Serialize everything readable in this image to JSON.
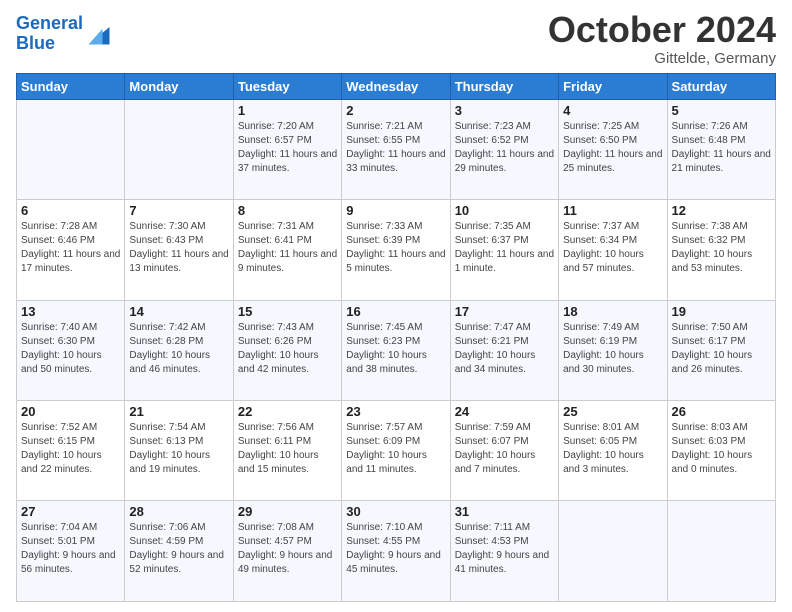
{
  "header": {
    "logo_general": "General",
    "logo_blue": "Blue",
    "month": "October 2024",
    "location": "Gittelde, Germany"
  },
  "days_of_week": [
    "Sunday",
    "Monday",
    "Tuesday",
    "Wednesday",
    "Thursday",
    "Friday",
    "Saturday"
  ],
  "weeks": [
    [
      {
        "day": "",
        "sunrise": "",
        "sunset": "",
        "daylight": ""
      },
      {
        "day": "",
        "sunrise": "",
        "sunset": "",
        "daylight": ""
      },
      {
        "day": "1",
        "sunrise": "Sunrise: 7:20 AM",
        "sunset": "Sunset: 6:57 PM",
        "daylight": "Daylight: 11 hours and 37 minutes."
      },
      {
        "day": "2",
        "sunrise": "Sunrise: 7:21 AM",
        "sunset": "Sunset: 6:55 PM",
        "daylight": "Daylight: 11 hours and 33 minutes."
      },
      {
        "day": "3",
        "sunrise": "Sunrise: 7:23 AM",
        "sunset": "Sunset: 6:52 PM",
        "daylight": "Daylight: 11 hours and 29 minutes."
      },
      {
        "day": "4",
        "sunrise": "Sunrise: 7:25 AM",
        "sunset": "Sunset: 6:50 PM",
        "daylight": "Daylight: 11 hours and 25 minutes."
      },
      {
        "day": "5",
        "sunrise": "Sunrise: 7:26 AM",
        "sunset": "Sunset: 6:48 PM",
        "daylight": "Daylight: 11 hours and 21 minutes."
      }
    ],
    [
      {
        "day": "6",
        "sunrise": "Sunrise: 7:28 AM",
        "sunset": "Sunset: 6:46 PM",
        "daylight": "Daylight: 11 hours and 17 minutes."
      },
      {
        "day": "7",
        "sunrise": "Sunrise: 7:30 AM",
        "sunset": "Sunset: 6:43 PM",
        "daylight": "Daylight: 11 hours and 13 minutes."
      },
      {
        "day": "8",
        "sunrise": "Sunrise: 7:31 AM",
        "sunset": "Sunset: 6:41 PM",
        "daylight": "Daylight: 11 hours and 9 minutes."
      },
      {
        "day": "9",
        "sunrise": "Sunrise: 7:33 AM",
        "sunset": "Sunset: 6:39 PM",
        "daylight": "Daylight: 11 hours and 5 minutes."
      },
      {
        "day": "10",
        "sunrise": "Sunrise: 7:35 AM",
        "sunset": "Sunset: 6:37 PM",
        "daylight": "Daylight: 11 hours and 1 minute."
      },
      {
        "day": "11",
        "sunrise": "Sunrise: 7:37 AM",
        "sunset": "Sunset: 6:34 PM",
        "daylight": "Daylight: 10 hours and 57 minutes."
      },
      {
        "day": "12",
        "sunrise": "Sunrise: 7:38 AM",
        "sunset": "Sunset: 6:32 PM",
        "daylight": "Daylight: 10 hours and 53 minutes."
      }
    ],
    [
      {
        "day": "13",
        "sunrise": "Sunrise: 7:40 AM",
        "sunset": "Sunset: 6:30 PM",
        "daylight": "Daylight: 10 hours and 50 minutes."
      },
      {
        "day": "14",
        "sunrise": "Sunrise: 7:42 AM",
        "sunset": "Sunset: 6:28 PM",
        "daylight": "Daylight: 10 hours and 46 minutes."
      },
      {
        "day": "15",
        "sunrise": "Sunrise: 7:43 AM",
        "sunset": "Sunset: 6:26 PM",
        "daylight": "Daylight: 10 hours and 42 minutes."
      },
      {
        "day": "16",
        "sunrise": "Sunrise: 7:45 AM",
        "sunset": "Sunset: 6:23 PM",
        "daylight": "Daylight: 10 hours and 38 minutes."
      },
      {
        "day": "17",
        "sunrise": "Sunrise: 7:47 AM",
        "sunset": "Sunset: 6:21 PM",
        "daylight": "Daylight: 10 hours and 34 minutes."
      },
      {
        "day": "18",
        "sunrise": "Sunrise: 7:49 AM",
        "sunset": "Sunset: 6:19 PM",
        "daylight": "Daylight: 10 hours and 30 minutes."
      },
      {
        "day": "19",
        "sunrise": "Sunrise: 7:50 AM",
        "sunset": "Sunset: 6:17 PM",
        "daylight": "Daylight: 10 hours and 26 minutes."
      }
    ],
    [
      {
        "day": "20",
        "sunrise": "Sunrise: 7:52 AM",
        "sunset": "Sunset: 6:15 PM",
        "daylight": "Daylight: 10 hours and 22 minutes."
      },
      {
        "day": "21",
        "sunrise": "Sunrise: 7:54 AM",
        "sunset": "Sunset: 6:13 PM",
        "daylight": "Daylight: 10 hours and 19 minutes."
      },
      {
        "day": "22",
        "sunrise": "Sunrise: 7:56 AM",
        "sunset": "Sunset: 6:11 PM",
        "daylight": "Daylight: 10 hours and 15 minutes."
      },
      {
        "day": "23",
        "sunrise": "Sunrise: 7:57 AM",
        "sunset": "Sunset: 6:09 PM",
        "daylight": "Daylight: 10 hours and 11 minutes."
      },
      {
        "day": "24",
        "sunrise": "Sunrise: 7:59 AM",
        "sunset": "Sunset: 6:07 PM",
        "daylight": "Daylight: 10 hours and 7 minutes."
      },
      {
        "day": "25",
        "sunrise": "Sunrise: 8:01 AM",
        "sunset": "Sunset: 6:05 PM",
        "daylight": "Daylight: 10 hours and 3 minutes."
      },
      {
        "day": "26",
        "sunrise": "Sunrise: 8:03 AM",
        "sunset": "Sunset: 6:03 PM",
        "daylight": "Daylight: 10 hours and 0 minutes."
      }
    ],
    [
      {
        "day": "27",
        "sunrise": "Sunrise: 7:04 AM",
        "sunset": "Sunset: 5:01 PM",
        "daylight": "Daylight: 9 hours and 56 minutes."
      },
      {
        "day": "28",
        "sunrise": "Sunrise: 7:06 AM",
        "sunset": "Sunset: 4:59 PM",
        "daylight": "Daylight: 9 hours and 52 minutes."
      },
      {
        "day": "29",
        "sunrise": "Sunrise: 7:08 AM",
        "sunset": "Sunset: 4:57 PM",
        "daylight": "Daylight: 9 hours and 49 minutes."
      },
      {
        "day": "30",
        "sunrise": "Sunrise: 7:10 AM",
        "sunset": "Sunset: 4:55 PM",
        "daylight": "Daylight: 9 hours and 45 minutes."
      },
      {
        "day": "31",
        "sunrise": "Sunrise: 7:11 AM",
        "sunset": "Sunset: 4:53 PM",
        "daylight": "Daylight: 9 hours and 41 minutes."
      },
      {
        "day": "",
        "sunrise": "",
        "sunset": "",
        "daylight": ""
      },
      {
        "day": "",
        "sunrise": "",
        "sunset": "",
        "daylight": ""
      }
    ]
  ]
}
